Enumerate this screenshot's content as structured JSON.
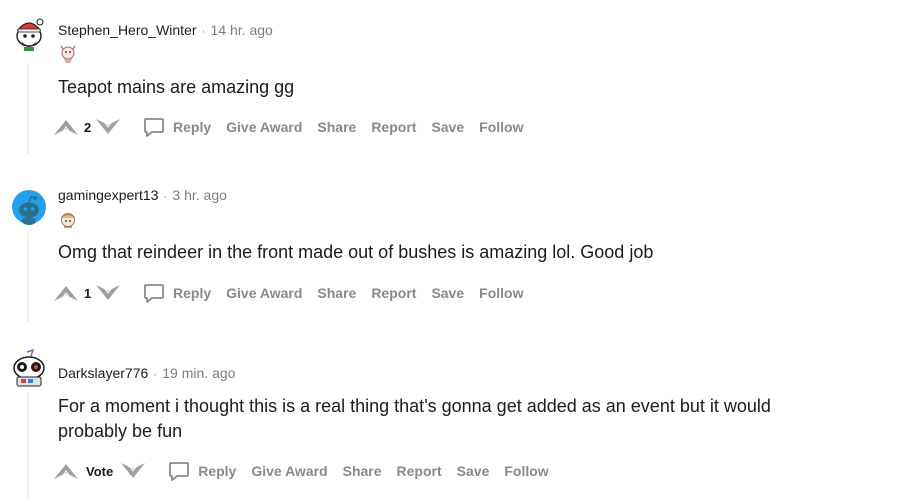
{
  "comments": [
    {
      "username": "Stephen_Hero_Winter",
      "separator": "·",
      "time": "14 hr. ago",
      "body": "Teapot mains are amazing gg",
      "votes": "2",
      "actions": {
        "reply": "Reply",
        "award": "Give Award",
        "share": "Share",
        "report": "Report",
        "save": "Save",
        "follow": "Follow"
      }
    },
    {
      "username": "gamingexpert13",
      "separator": "·",
      "time": "3 hr. ago",
      "body": "Omg that reindeer in the front made out of bushes is amazing lol. Good job",
      "votes": "1",
      "actions": {
        "reply": "Reply",
        "award": "Give Award",
        "share": "Share",
        "report": "Report",
        "save": "Save",
        "follow": "Follow"
      }
    },
    {
      "username": "Darkslayer776",
      "separator": "·",
      "time": "19 min. ago",
      "body": "For a moment i thought this is a real thing that's gonna get added as an event but it would probably be fun",
      "votes": "Vote",
      "actions": {
        "reply": "Reply",
        "award": "Give Award",
        "share": "Share",
        "report": "Report",
        "save": "Save",
        "follow": "Follow"
      }
    }
  ],
  "colors": {
    "thread_line": "#edeff1",
    "action_text": "#878a8c",
    "avatar2_bg": "#24a0ed"
  },
  "icons": {
    "upvote": "upvote-arrow-icon",
    "downvote": "downvote-arrow-icon",
    "reply": "speech-bubble-icon"
  }
}
